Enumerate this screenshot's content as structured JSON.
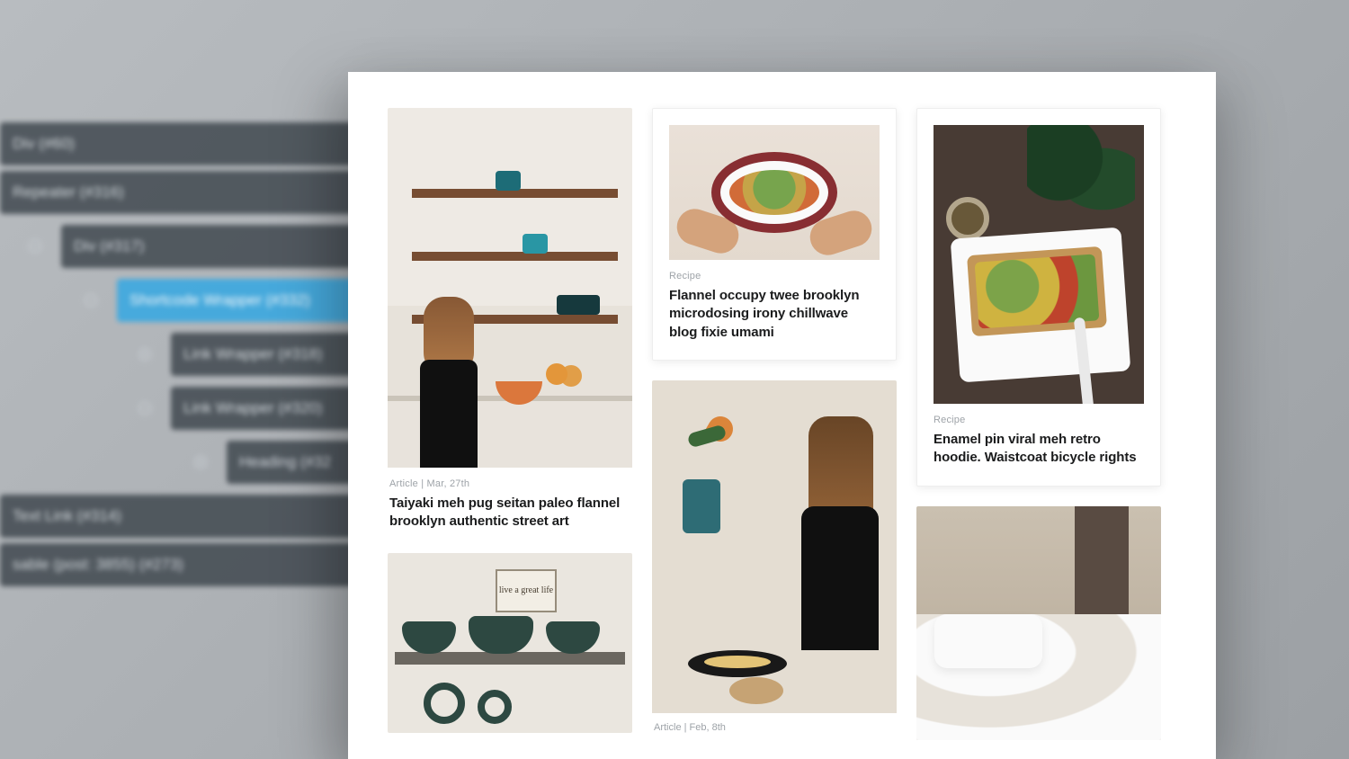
{
  "tree": {
    "items": [
      {
        "label": "Div (#60)",
        "indent": 1,
        "icon": "none",
        "selected": false
      },
      {
        "label": "Repeater (#316)",
        "indent": 1,
        "icon": "none",
        "selected": false
      },
      {
        "label": "Div (#317)",
        "indent": 2,
        "icon": "collapse",
        "selected": false
      },
      {
        "label": "Shortcode Wrapper (#332)",
        "indent": 3,
        "icon": "none",
        "selected": true
      },
      {
        "label": "Link Wrapper (#318)",
        "indent": 4,
        "icon": "expand",
        "selected": false
      },
      {
        "label": "Link Wrapper (#320)",
        "indent": 4,
        "icon": "collapse",
        "selected": false
      },
      {
        "label": "Heading (#32",
        "indent": 5,
        "icon": "expand",
        "selected": false
      },
      {
        "label": "Text Link (#314)",
        "indent": 1,
        "icon": "none",
        "selected": false
      },
      {
        "label": "sable (post: 3855) (#273)",
        "indent": 0,
        "icon": "none",
        "selected": false
      }
    ]
  },
  "cards": [
    {
      "meta": "Article |  Mar, 27th",
      "title": "Taiyaki meh pug seitan paleo flannel brooklyn authentic street art"
    },
    {
      "meta": "Recipe",
      "title": "Flannel occupy twee brooklyn microdosing irony chillwave blog fixie umami"
    },
    {
      "meta": "Article |  Feb, 8th",
      "title": ""
    },
    {
      "meta": "Recipe",
      "title": "Enamel pin viral meh retro hoodie. Waistcoat bicycle rights"
    }
  ],
  "shelf_sign": "live a great life"
}
